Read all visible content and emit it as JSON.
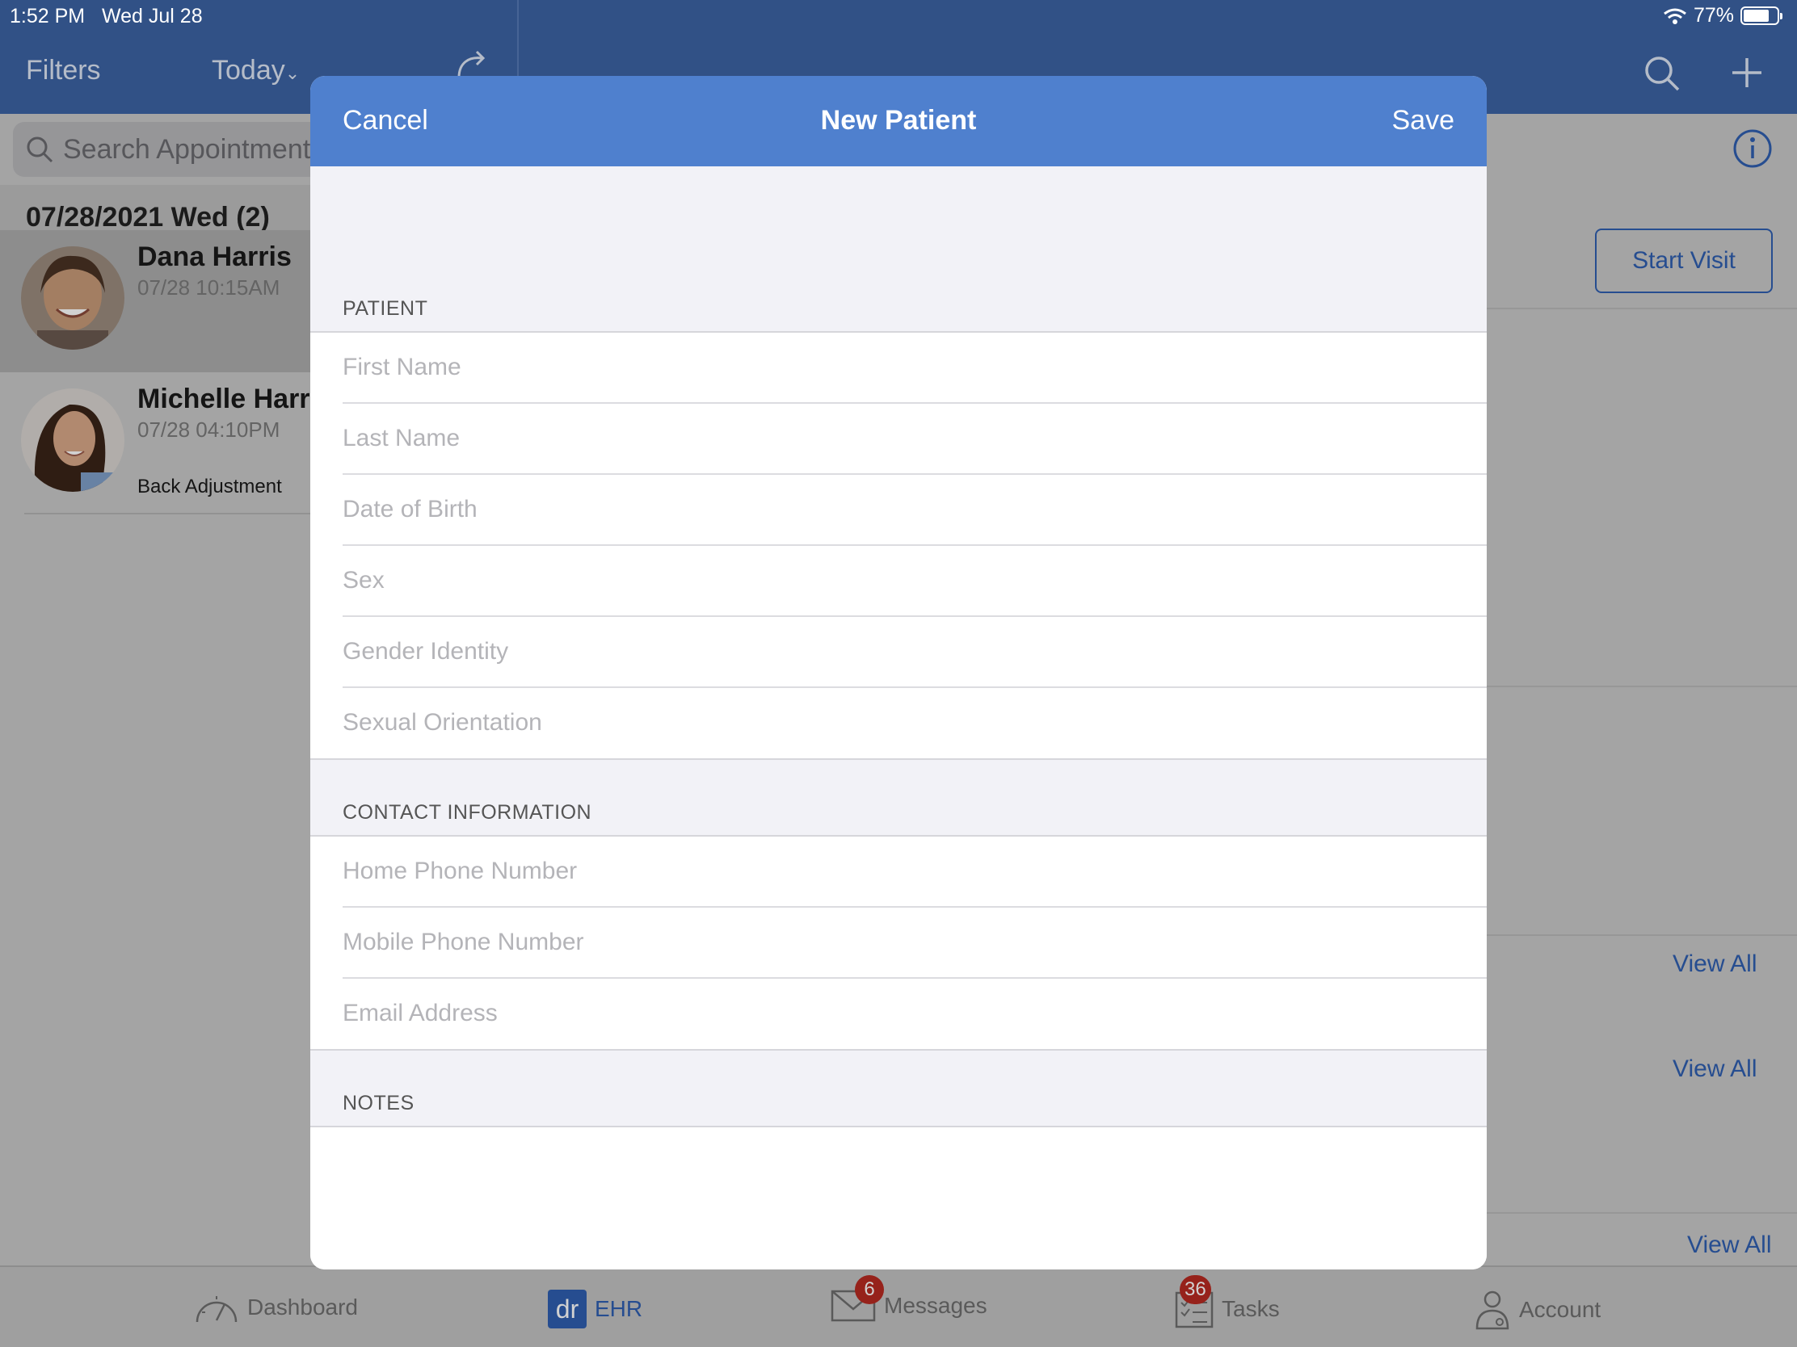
{
  "status": {
    "time": "1:52 PM",
    "date": "Wed Jul 28",
    "battery": "77%",
    "battery_level": 0.77
  },
  "header": {
    "filters": "Filters",
    "today": "Today"
  },
  "left": {
    "search_placeholder": "Search Appointments",
    "date_header": "07/28/2021 Wed (2)",
    "appointments": [
      {
        "name": "Dana Harris",
        "time": "07/28 10:15AM",
        "reason": ""
      },
      {
        "name": "Michelle Harris",
        "time": "07/28 04:10PM",
        "reason": "Back Adjustment"
      }
    ]
  },
  "right": {
    "start_visit": "Start Visit",
    "view_all": "View All"
  },
  "modal": {
    "cancel": "Cancel",
    "title": "New Patient",
    "save": "Save",
    "sections": {
      "patient": "PATIENT",
      "contact": "CONTACT INFORMATION",
      "notes": "NOTES"
    },
    "fields": {
      "first_name": "First Name",
      "last_name": "Last Name",
      "dob": "Date of Birth",
      "sex": "Sex",
      "gender_identity": "Gender Identity",
      "sexual_orientation": "Sexual Orientation",
      "home_phone": "Home Phone Number",
      "mobile_phone": "Mobile Phone Number",
      "email": "Email Address"
    }
  },
  "tabs": [
    {
      "label": "Dashboard",
      "icon": "speedometer-icon",
      "badge": ""
    },
    {
      "label": "EHR",
      "icon": "dr-logo-icon",
      "badge": ""
    },
    {
      "label": "Messages",
      "icon": "envelope-icon",
      "badge": "6"
    },
    {
      "label": "Tasks",
      "icon": "checklist-icon",
      "badge": "36"
    },
    {
      "label": "Account",
      "icon": "doctor-icon",
      "badge": ""
    }
  ],
  "colors": {
    "header_blue": "#3c63a4",
    "modal_header": "#4f80ce",
    "accent": "#2f5fb0",
    "badge_red": "#b72a22"
  }
}
